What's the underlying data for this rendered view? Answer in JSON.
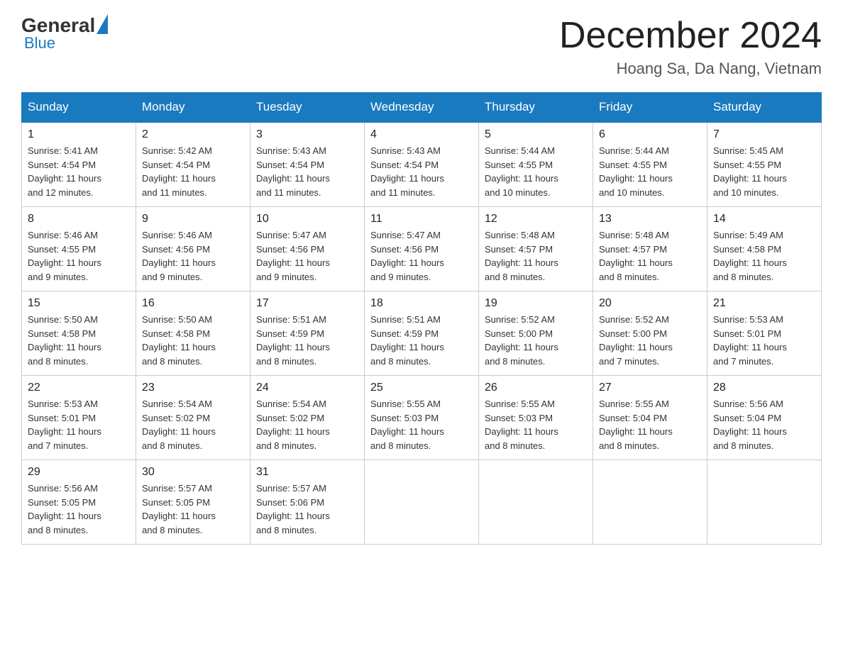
{
  "header": {
    "logo_general": "General",
    "logo_blue": "Blue",
    "month_title": "December 2024",
    "location": "Hoang Sa, Da Nang, Vietnam"
  },
  "weekdays": [
    "Sunday",
    "Monday",
    "Tuesday",
    "Wednesday",
    "Thursday",
    "Friday",
    "Saturday"
  ],
  "weeks": [
    [
      {
        "day": "1",
        "sunrise": "5:41 AM",
        "sunset": "4:54 PM",
        "daylight": "11 hours and 12 minutes."
      },
      {
        "day": "2",
        "sunrise": "5:42 AM",
        "sunset": "4:54 PM",
        "daylight": "11 hours and 11 minutes."
      },
      {
        "day": "3",
        "sunrise": "5:43 AM",
        "sunset": "4:54 PM",
        "daylight": "11 hours and 11 minutes."
      },
      {
        "day": "4",
        "sunrise": "5:43 AM",
        "sunset": "4:54 PM",
        "daylight": "11 hours and 11 minutes."
      },
      {
        "day": "5",
        "sunrise": "5:44 AM",
        "sunset": "4:55 PM",
        "daylight": "11 hours and 10 minutes."
      },
      {
        "day": "6",
        "sunrise": "5:44 AM",
        "sunset": "4:55 PM",
        "daylight": "11 hours and 10 minutes."
      },
      {
        "day": "7",
        "sunrise": "5:45 AM",
        "sunset": "4:55 PM",
        "daylight": "11 hours and 10 minutes."
      }
    ],
    [
      {
        "day": "8",
        "sunrise": "5:46 AM",
        "sunset": "4:55 PM",
        "daylight": "11 hours and 9 minutes."
      },
      {
        "day": "9",
        "sunrise": "5:46 AM",
        "sunset": "4:56 PM",
        "daylight": "11 hours and 9 minutes."
      },
      {
        "day": "10",
        "sunrise": "5:47 AM",
        "sunset": "4:56 PM",
        "daylight": "11 hours and 9 minutes."
      },
      {
        "day": "11",
        "sunrise": "5:47 AM",
        "sunset": "4:56 PM",
        "daylight": "11 hours and 9 minutes."
      },
      {
        "day": "12",
        "sunrise": "5:48 AM",
        "sunset": "4:57 PM",
        "daylight": "11 hours and 8 minutes."
      },
      {
        "day": "13",
        "sunrise": "5:48 AM",
        "sunset": "4:57 PM",
        "daylight": "11 hours and 8 minutes."
      },
      {
        "day": "14",
        "sunrise": "5:49 AM",
        "sunset": "4:58 PM",
        "daylight": "11 hours and 8 minutes."
      }
    ],
    [
      {
        "day": "15",
        "sunrise": "5:50 AM",
        "sunset": "4:58 PM",
        "daylight": "11 hours and 8 minutes."
      },
      {
        "day": "16",
        "sunrise": "5:50 AM",
        "sunset": "4:58 PM",
        "daylight": "11 hours and 8 minutes."
      },
      {
        "day": "17",
        "sunrise": "5:51 AM",
        "sunset": "4:59 PM",
        "daylight": "11 hours and 8 minutes."
      },
      {
        "day": "18",
        "sunrise": "5:51 AM",
        "sunset": "4:59 PM",
        "daylight": "11 hours and 8 minutes."
      },
      {
        "day": "19",
        "sunrise": "5:52 AM",
        "sunset": "5:00 PM",
        "daylight": "11 hours and 8 minutes."
      },
      {
        "day": "20",
        "sunrise": "5:52 AM",
        "sunset": "5:00 PM",
        "daylight": "11 hours and 7 minutes."
      },
      {
        "day": "21",
        "sunrise": "5:53 AM",
        "sunset": "5:01 PM",
        "daylight": "11 hours and 7 minutes."
      }
    ],
    [
      {
        "day": "22",
        "sunrise": "5:53 AM",
        "sunset": "5:01 PM",
        "daylight": "11 hours and 7 minutes."
      },
      {
        "day": "23",
        "sunrise": "5:54 AM",
        "sunset": "5:02 PM",
        "daylight": "11 hours and 8 minutes."
      },
      {
        "day": "24",
        "sunrise": "5:54 AM",
        "sunset": "5:02 PM",
        "daylight": "11 hours and 8 minutes."
      },
      {
        "day": "25",
        "sunrise": "5:55 AM",
        "sunset": "5:03 PM",
        "daylight": "11 hours and 8 minutes."
      },
      {
        "day": "26",
        "sunrise": "5:55 AM",
        "sunset": "5:03 PM",
        "daylight": "11 hours and 8 minutes."
      },
      {
        "day": "27",
        "sunrise": "5:55 AM",
        "sunset": "5:04 PM",
        "daylight": "11 hours and 8 minutes."
      },
      {
        "day": "28",
        "sunrise": "5:56 AM",
        "sunset": "5:04 PM",
        "daylight": "11 hours and 8 minutes."
      }
    ],
    [
      {
        "day": "29",
        "sunrise": "5:56 AM",
        "sunset": "5:05 PM",
        "daylight": "11 hours and 8 minutes."
      },
      {
        "day": "30",
        "sunrise": "5:57 AM",
        "sunset": "5:05 PM",
        "daylight": "11 hours and 8 minutes."
      },
      {
        "day": "31",
        "sunrise": "5:57 AM",
        "sunset": "5:06 PM",
        "daylight": "11 hours and 8 minutes."
      },
      null,
      null,
      null,
      null
    ]
  ],
  "labels": {
    "sunrise": "Sunrise:",
    "sunset": "Sunset:",
    "daylight": "Daylight:"
  }
}
